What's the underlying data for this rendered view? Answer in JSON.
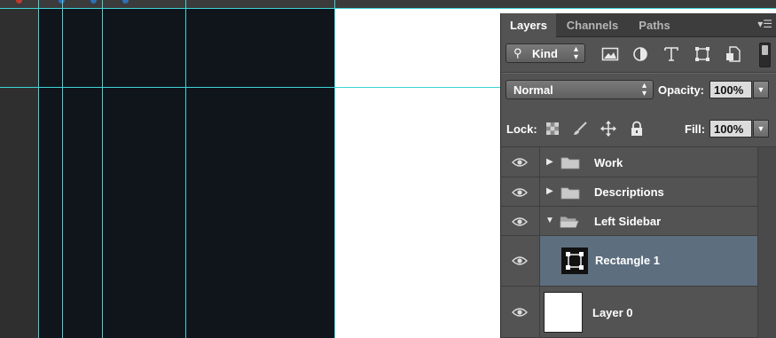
{
  "tabs": [
    {
      "label": "Layers",
      "active": true
    },
    {
      "label": "Channels",
      "active": false
    },
    {
      "label": "Paths",
      "active": false
    }
  ],
  "panel_menu_icon": "panel-menu-icon",
  "filter": {
    "kind_label": "Kind",
    "icons": [
      "pixel-layer-filter-icon",
      "adjustment-layer-filter-icon",
      "type-layer-filter-icon",
      "shape-layer-filter-icon",
      "smart-object-filter-icon"
    ]
  },
  "blend": {
    "mode": "Normal",
    "opacity_label": "Opacity:",
    "opacity_value": "100%"
  },
  "lock": {
    "label": "Lock:",
    "icons": [
      "lock-transparent-pixels-icon",
      "lock-image-pixels-icon",
      "lock-position-icon",
      "lock-all-icon"
    ],
    "fill_label": "Fill:",
    "fill_value": "100%"
  },
  "layers": [
    {
      "name": "Work",
      "type": "group",
      "expanded": false,
      "selected": false
    },
    {
      "name": "Descriptions",
      "type": "group",
      "expanded": false,
      "selected": false
    },
    {
      "name": "Left Sidebar",
      "type": "group",
      "expanded": true,
      "selected": false
    },
    {
      "name": "Rectangle 1",
      "type": "shape",
      "selected": true
    },
    {
      "name": "Layer 0",
      "type": "pixel",
      "selected": false
    }
  ],
  "colors": {
    "guide": "#3fd3d6",
    "canvas_dark": "#10151c",
    "panel_bg": "#535353",
    "selected_row": "#5d6e7f"
  }
}
